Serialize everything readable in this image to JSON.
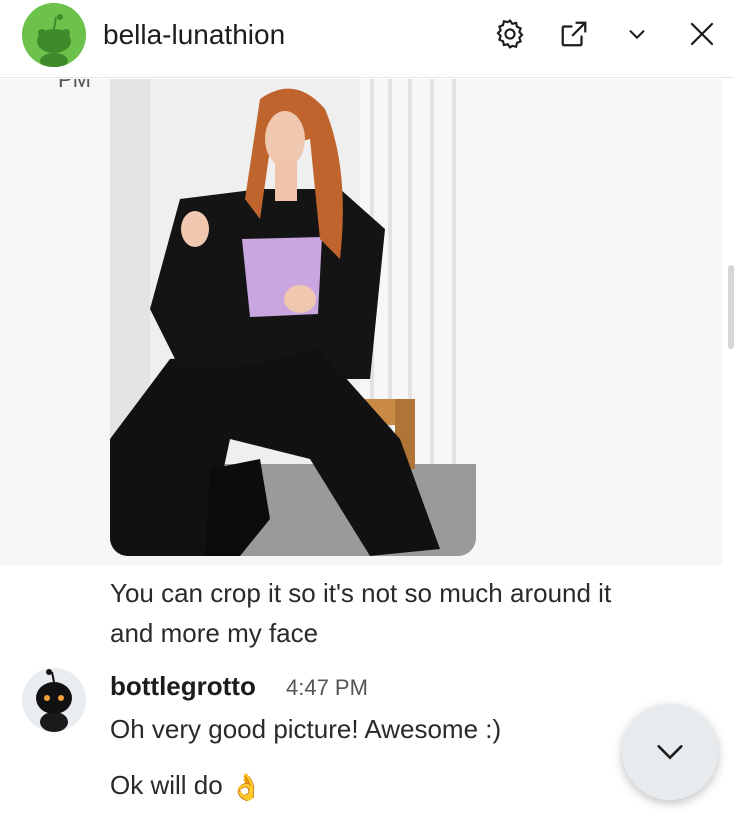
{
  "header": {
    "title": "bella-lunathion",
    "avatar_icon": "reddit-snoo-avatar-icon",
    "buttons": [
      "settings-gear-icon",
      "open-in-new-window-icon",
      "chevron-down-icon",
      "close-icon"
    ]
  },
  "messages": {
    "partial_time": "PM",
    "image_alt": "Photo of a person in a black suit and lavender corset sitting on a bench",
    "text_1_line_1": "You can crop it so it's not so much around it",
    "text_1_line_2": "and more my face",
    "reply": {
      "username": "bottlegrotto",
      "time": "4:47 PM",
      "line_1": "Oh very good picture! Awesome :)",
      "line_2": "Ok will do",
      "emoji": "👌"
    }
  },
  "colors": {
    "brand_green": "#6cc24a",
    "highlight_bg": "#f6f6f6",
    "fab_bg": "#e7ebee"
  }
}
